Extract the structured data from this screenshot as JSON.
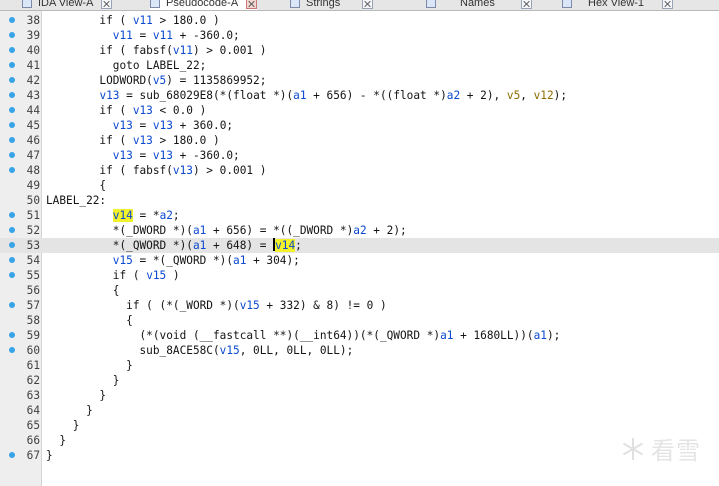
{
  "tabs": [
    {
      "label": "IDA View-A",
      "active": false
    },
    {
      "label": "Pseudocode-A",
      "active": true
    },
    {
      "label": "Strings",
      "active": false
    },
    {
      "label": "Names",
      "active": false
    },
    {
      "label": "Hex View-1",
      "active": false
    }
  ],
  "lines": [
    {
      "num": "38",
      "dot": true,
      "segs": [
        {
          "t": "        if ( "
        },
        {
          "t": "v11",
          "c": "v"
        },
        {
          "t": " > 180.0 )"
        }
      ]
    },
    {
      "num": "39",
      "dot": true,
      "segs": [
        {
          "t": "          "
        },
        {
          "t": "v11",
          "c": "v"
        },
        {
          "t": " = "
        },
        {
          "t": "v11",
          "c": "v"
        },
        {
          "t": " + -360.0;"
        }
      ]
    },
    {
      "num": "40",
      "dot": true,
      "segs": [
        {
          "t": "        if ( fabsf("
        },
        {
          "t": "v11",
          "c": "v"
        },
        {
          "t": ") > 0.001 )"
        }
      ]
    },
    {
      "num": "41",
      "dot": true,
      "segs": [
        {
          "t": "          goto LABEL_22;"
        }
      ]
    },
    {
      "num": "42",
      "dot": true,
      "segs": [
        {
          "t": "        LODWORD("
        },
        {
          "t": "v5",
          "c": "v"
        },
        {
          "t": ") = 1135869952;"
        }
      ]
    },
    {
      "num": "43",
      "dot": true,
      "segs": [
        {
          "t": "        "
        },
        {
          "t": "v13",
          "c": "v"
        },
        {
          "t": " = sub_68029E8(*(float *)("
        },
        {
          "t": "a1",
          "c": "v"
        },
        {
          "t": " + 656) - *((float *)"
        },
        {
          "t": "a2",
          "c": "v"
        },
        {
          "t": " + 2), "
        },
        {
          "t": "v5",
          "c": "v o"
        },
        {
          "t": ", "
        },
        {
          "t": "v12",
          "c": "v o"
        },
        {
          "t": ");"
        }
      ]
    },
    {
      "num": "44",
      "dot": true,
      "segs": [
        {
          "t": "        if ( "
        },
        {
          "t": "v13",
          "c": "v"
        },
        {
          "t": " < 0.0 )"
        }
      ]
    },
    {
      "num": "45",
      "dot": true,
      "segs": [
        {
          "t": "          "
        },
        {
          "t": "v13",
          "c": "v"
        },
        {
          "t": " = "
        },
        {
          "t": "v13",
          "c": "v"
        },
        {
          "t": " + 360.0;"
        }
      ]
    },
    {
      "num": "46",
      "dot": true,
      "segs": [
        {
          "t": "        if ( "
        },
        {
          "t": "v13",
          "c": "v"
        },
        {
          "t": " > 180.0 )"
        }
      ]
    },
    {
      "num": "47",
      "dot": true,
      "segs": [
        {
          "t": "          "
        },
        {
          "t": "v13",
          "c": "v"
        },
        {
          "t": " = "
        },
        {
          "t": "v13",
          "c": "v"
        },
        {
          "t": " + -360.0;"
        }
      ]
    },
    {
      "num": "48",
      "dot": true,
      "segs": [
        {
          "t": "        if ( fabsf("
        },
        {
          "t": "v13",
          "c": "v"
        },
        {
          "t": ") > 0.001 )"
        }
      ]
    },
    {
      "num": "49",
      "dot": false,
      "segs": [
        {
          "t": "        {"
        }
      ]
    },
    {
      "num": "50",
      "dot": false,
      "segs": [
        {
          "t": "LABEL_22:"
        }
      ]
    },
    {
      "num": "51",
      "dot": true,
      "segs": [
        {
          "t": "          "
        },
        {
          "t": "v14",
          "c": "v mark"
        },
        {
          "t": " = *"
        },
        {
          "t": "a2",
          "c": "v"
        },
        {
          "t": ";"
        }
      ]
    },
    {
      "num": "52",
      "dot": true,
      "segs": [
        {
          "t": "          *(_DWORD *)("
        },
        {
          "t": "a1",
          "c": "v"
        },
        {
          "t": " + 656) = *((_DWORD *)"
        },
        {
          "t": "a2",
          "c": "v"
        },
        {
          "t": " + 2);"
        }
      ]
    },
    {
      "num": "53",
      "dot": true,
      "hl": true,
      "segs": [
        {
          "t": "          *(_QWORD *)("
        },
        {
          "t": "a1",
          "c": "v"
        },
        {
          "t": " + 648) = "
        },
        {
          "t": "",
          "c": "cursor"
        },
        {
          "t": "v14",
          "c": "v mark"
        },
        {
          "t": ";"
        }
      ]
    },
    {
      "num": "54",
      "dot": true,
      "segs": [
        {
          "t": "          "
        },
        {
          "t": "v15",
          "c": "v"
        },
        {
          "t": " = *(_QWORD *)("
        },
        {
          "t": "a1",
          "c": "v"
        },
        {
          "t": " + 304);"
        }
      ]
    },
    {
      "num": "55",
      "dot": true,
      "segs": [
        {
          "t": "          if ( "
        },
        {
          "t": "v15",
          "c": "v"
        },
        {
          "t": " )"
        }
      ]
    },
    {
      "num": "56",
      "dot": false,
      "segs": [
        {
          "t": "          {"
        }
      ]
    },
    {
      "num": "57",
      "dot": true,
      "segs": [
        {
          "t": "            if ( (*(_WORD *)("
        },
        {
          "t": "v15",
          "c": "v"
        },
        {
          "t": " + 332) & 8) != 0 )"
        }
      ]
    },
    {
      "num": "58",
      "dot": false,
      "segs": [
        {
          "t": "            {"
        }
      ]
    },
    {
      "num": "59",
      "dot": true,
      "segs": [
        {
          "t": "              (*(void (__fastcall **)(__int64))(*(_QWORD *)"
        },
        {
          "t": "a1",
          "c": "v"
        },
        {
          "t": " + 1680LL))("
        },
        {
          "t": "a1",
          "c": "v"
        },
        {
          "t": ");"
        }
      ]
    },
    {
      "num": "60",
      "dot": true,
      "segs": [
        {
          "t": "              sub_8ACE58C("
        },
        {
          "t": "v15",
          "c": "v"
        },
        {
          "t": ", 0LL, 0LL, 0LL);"
        }
      ]
    },
    {
      "num": "61",
      "dot": false,
      "segs": [
        {
          "t": "            }"
        }
      ]
    },
    {
      "num": "62",
      "dot": false,
      "segs": [
        {
          "t": "          }"
        }
      ]
    },
    {
      "num": "63",
      "dot": false,
      "segs": [
        {
          "t": "        }"
        }
      ]
    },
    {
      "num": "64",
      "dot": false,
      "segs": [
        {
          "t": "      }"
        }
      ]
    },
    {
      "num": "65",
      "dot": false,
      "segs": [
        {
          "t": "    }"
        }
      ]
    },
    {
      "num": "66",
      "dot": false,
      "segs": [
        {
          "t": "  }"
        }
      ]
    },
    {
      "num": "67",
      "dot": true,
      "segs": [
        {
          "t": "}"
        }
      ]
    }
  ],
  "watermark": "看雪",
  "colors": {
    "variable": "#0a48d0",
    "highlight": "#f2f22c",
    "breakpoint_dot": "#38a3e6"
  }
}
